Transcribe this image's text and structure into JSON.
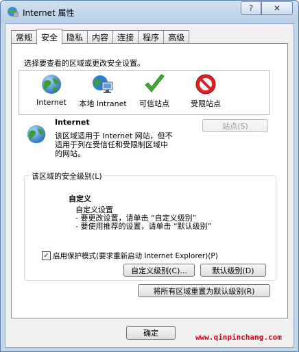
{
  "window": {
    "title": "Internet 属性",
    "help_label": "?",
    "close_label": "✕"
  },
  "tabs": [
    {
      "label": "常规"
    },
    {
      "label": "安全",
      "active": true
    },
    {
      "label": "隐私"
    },
    {
      "label": "内容"
    },
    {
      "label": "连接"
    },
    {
      "label": "程序"
    },
    {
      "label": "高级"
    }
  ],
  "security": {
    "zone_prompt": "选择要查看的区域或更改安全设置。",
    "zones": [
      {
        "label": "Internet",
        "icon": "globe-icon"
      },
      {
        "label": "本地 Intranet",
        "icon": "intranet-icon"
      },
      {
        "label": "可信站点",
        "icon": "checkmark-icon"
      },
      {
        "label": "受限站点",
        "icon": "restricted-icon"
      }
    ],
    "selected_zone_title": "Internet",
    "selected_zone_desc": [
      "该区域适用于 Internet 网站，但不",
      "适用于列在受信任和受限制区域中",
      "的网站。"
    ],
    "sites_button": "站点(S)",
    "level_group_label": "该区域的安全级别(L)",
    "level_title": "自定义",
    "level_desc": [
      "自定义设置",
      "- 要更改设置，请单击 “自定义级别”",
      "- 要使用推荐的设置，请单击 “默认级别”"
    ],
    "protected_mode_label": "启用保护模式(要求重新启动 Internet Explorer)(P)",
    "protected_mode_checked": true,
    "custom_level_button": "自定义级别(C)...",
    "default_level_button": "默认级别(D)",
    "reset_all_button": "将所有区域重置为默认级别(R)"
  },
  "footer": {
    "ok_button": "确定"
  },
  "watermark": "www.qinpinchang.com"
}
